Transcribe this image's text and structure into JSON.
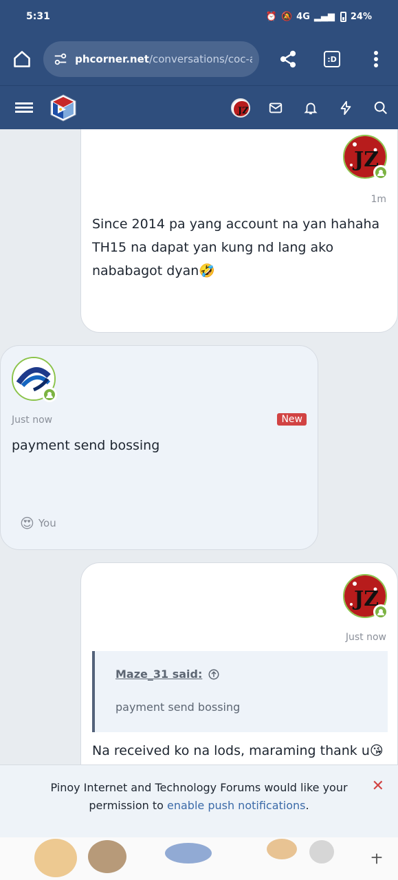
{
  "status_bar": {
    "time": "5:31",
    "network": "4G",
    "battery": "24%"
  },
  "browser": {
    "url_host": "phcorner.net",
    "url_path": "/conversations/coc-a",
    "tabs_label": ":D"
  },
  "messages": [
    {
      "time": "1m",
      "lines": [
        "Since 2014 pa yang account na yan hahaha",
        "TH15 na dapat yan kung nd lang ako",
        "nababagot dyan🤣"
      ]
    },
    {
      "time": "Just now",
      "badge": "New",
      "text": "payment send bossing",
      "reaction_emoji": "😍",
      "reaction_user": "You"
    },
    {
      "time": "Just now",
      "quote_author": "Maze_31 said:",
      "quote_text": "payment send bossing",
      "text": "Na received ko na lods, maraming thank u😘"
    }
  ],
  "push_banner": {
    "line1": "Pinoy Internet and Technology Forums would like your",
    "line2_prefix": "permission to ",
    "link": "enable push notifications",
    "line2_suffix": "."
  },
  "colors": {
    "header": "#2f4e7d",
    "badge": "#d14343",
    "online": "#7cb342"
  }
}
